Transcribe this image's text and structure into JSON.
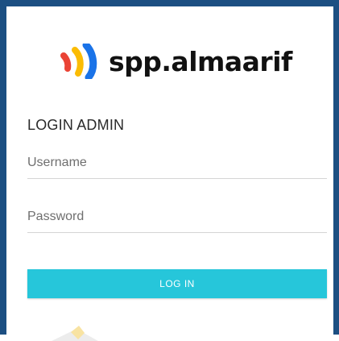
{
  "brand": {
    "name": "spp.almaarif",
    "logo_icon": "wifi-signal-logo-icon",
    "logo_colors": [
      "#1a73e8",
      "#fbbc04",
      "#ea4335"
    ]
  },
  "login": {
    "title": "LOGIN ADMIN",
    "username_placeholder": "Username",
    "password_placeholder": "Password",
    "button_label": "LOG IN"
  },
  "colors": {
    "frame_border": "#1c4f82",
    "button_accent": "#26c6da"
  }
}
